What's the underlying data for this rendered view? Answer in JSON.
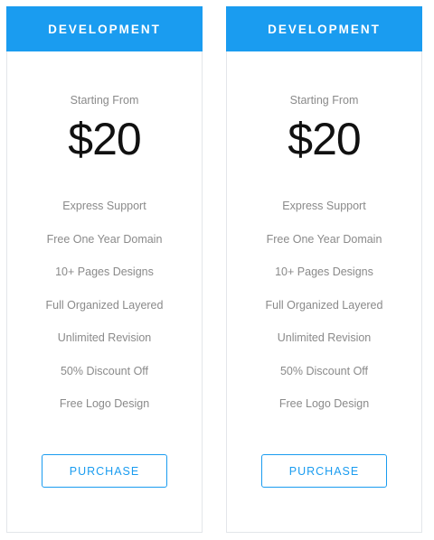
{
  "colors": {
    "accent": "#1a9cf0",
    "muted_text": "#8a8a8a",
    "price_text": "#111111",
    "border": "#e3e6ea"
  },
  "cards": [
    {
      "title": "DEVELOPMENT",
      "starting_label": "Starting From",
      "price": "$20",
      "features": [
        "Express Support",
        "Free One Year Domain",
        "10+ Pages Designs",
        "Full Organized Layered",
        "Unlimited Revision",
        "50% Discount Off",
        "Free Logo Design"
      ],
      "button_label": "PURCHASE"
    },
    {
      "title": "DEVELOPMENT",
      "starting_label": "Starting From",
      "price": "$20",
      "features": [
        "Express Support",
        "Free One Year Domain",
        "10+ Pages Designs",
        "Full Organized Layered",
        "Unlimited Revision",
        "50% Discount Off",
        "Free Logo Design"
      ],
      "button_label": "PURCHASE"
    }
  ]
}
